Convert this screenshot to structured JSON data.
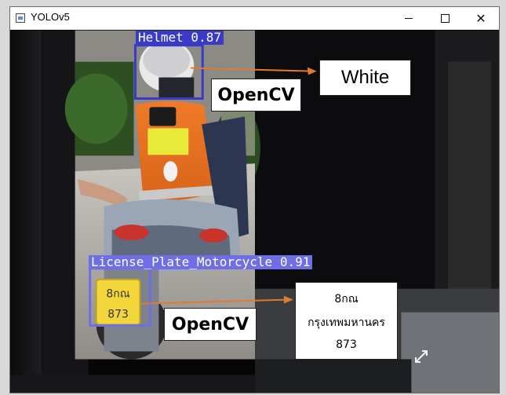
{
  "window": {
    "title": "YOLOv5",
    "icon": "app-icon",
    "controls": [
      "minimize-icon",
      "maximize-icon",
      "close-icon"
    ],
    "close_glyph": "✕"
  },
  "detections": [
    {
      "label": "Helmet 0.87",
      "color": "#3a3ac8"
    },
    {
      "label": "License_Plate_Motorcycle 0.91",
      "color": "#6e6ee6"
    }
  ],
  "annotations": {
    "opencv_top": "OpenCV",
    "opencv_bottom": "OpenCV",
    "helmet_color": "White",
    "plate_text": {
      "line1": "8กณ",
      "line2": "กรุงเทพมหานคร",
      "line3": "873"
    },
    "arrow_color": "#e07b2e"
  },
  "scene": {
    "license_plate_print": {
      "top": "8กณ",
      "bottom": "873"
    },
    "overlay_icon": "expand-icon"
  }
}
